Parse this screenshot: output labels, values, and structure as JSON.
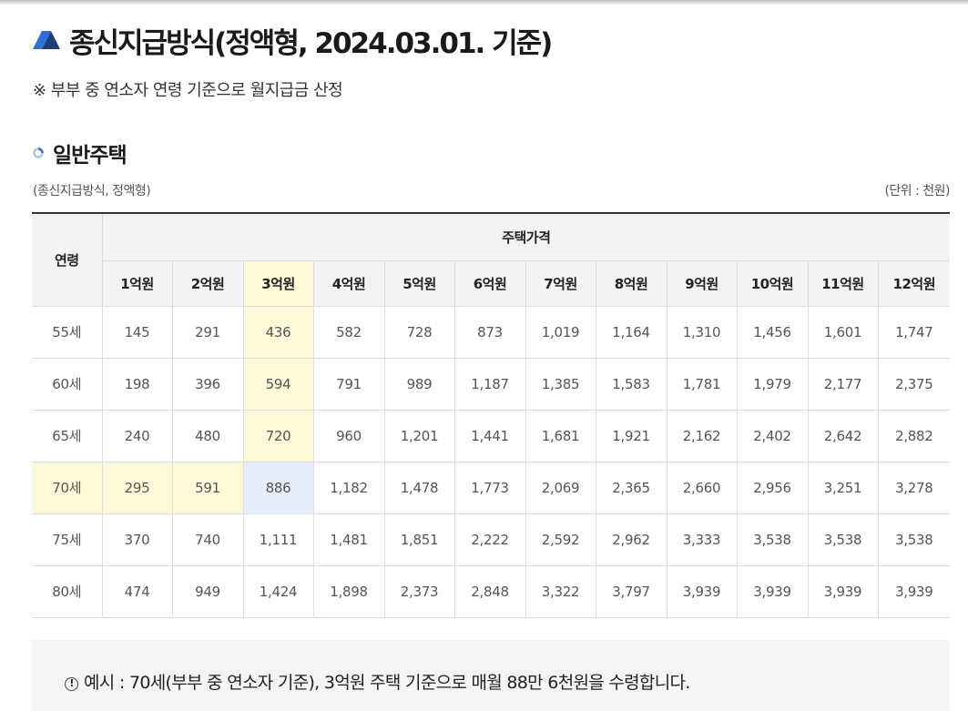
{
  "page": {
    "title": "종신지급방식(정액형, 2024.03.01. 기준)",
    "note": "※ 부부 중 연소자 연령 기준으로 월지급금 산정"
  },
  "section": {
    "title": "일반주택",
    "caption_left": "(종신지급방식, 정액형)",
    "caption_right": "(단위 : 천원)"
  },
  "table": {
    "age_header": "연령",
    "group_header": "주택가격",
    "columns": [
      "1억원",
      "2억원",
      "3억원",
      "4억원",
      "5억원",
      "6억원",
      "7억원",
      "8억원",
      "9억원",
      "10억원",
      "11억원",
      "12억원"
    ],
    "rows": [
      {
        "age": "55세",
        "values": [
          "145",
          "291",
          "436",
          "582",
          "728",
          "873",
          "1,019",
          "1,164",
          "1,310",
          "1,456",
          "1,601",
          "1,747"
        ]
      },
      {
        "age": "60세",
        "values": [
          "198",
          "396",
          "594",
          "791",
          "989",
          "1,187",
          "1,385",
          "1,583",
          "1,781",
          "1,979",
          "2,177",
          "2,375"
        ]
      },
      {
        "age": "65세",
        "values": [
          "240",
          "480",
          "720",
          "960",
          "1,201",
          "1,441",
          "1,681",
          "1,921",
          "2,162",
          "2,402",
          "2,642",
          "2,882"
        ]
      },
      {
        "age": "70세",
        "values": [
          "295",
          "591",
          "886",
          "1,182",
          "1,478",
          "1,773",
          "2,069",
          "2,365",
          "2,660",
          "2,956",
          "3,251",
          "3,278"
        ]
      },
      {
        "age": "75세",
        "values": [
          "370",
          "740",
          "1,111",
          "1,481",
          "1,851",
          "2,222",
          "2,592",
          "2,962",
          "3,333",
          "3,538",
          "3,538",
          "3,538"
        ]
      },
      {
        "age": "80세",
        "values": [
          "474",
          "949",
          "1,424",
          "1,898",
          "2,373",
          "2,848",
          "3,322",
          "3,797",
          "3,939",
          "3,939",
          "3,939",
          "3,939"
        ]
      }
    ],
    "highlight": {
      "column": "3억원",
      "row": "70세",
      "cell_color": "#e7eefb",
      "line_color": "#fdf9d8"
    }
  },
  "example": {
    "icon": "exclamation-circle-icon",
    "text": "예시 : 70세(부부 중 연소자 기준), 3억원 주택 기준으로 매월 88만 6천원을 수령합니다."
  },
  "colors": {
    "accent_blue": "#2f6fd6",
    "accent_navy": "#1f3d7a",
    "header_bg": "#f3f3f3",
    "highlight_yellow": "#fdf9d8",
    "highlight_blue": "#e7eefb"
  }
}
